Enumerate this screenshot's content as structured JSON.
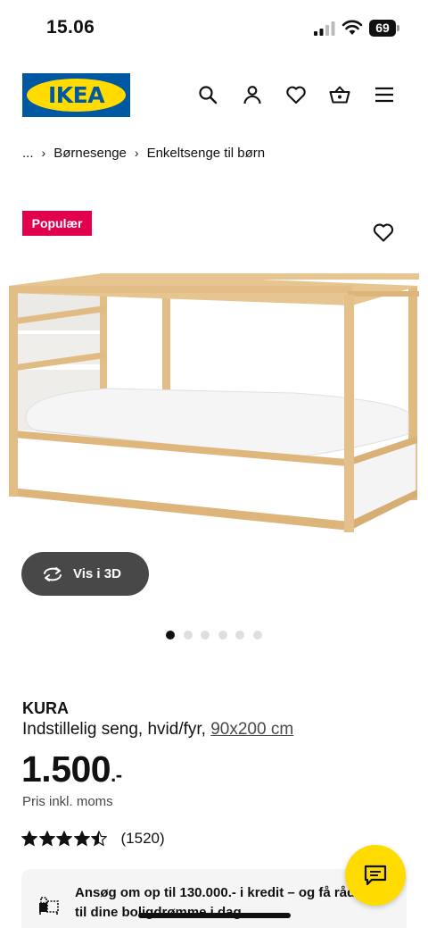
{
  "status_bar": {
    "time": "15.06",
    "battery": "69"
  },
  "header": {
    "logo_text": "IKEA",
    "icons": [
      "search-icon",
      "profile-icon",
      "heart-icon",
      "basket-icon",
      "menu-icon"
    ]
  },
  "breadcrumb": {
    "items": [
      "...",
      "Børnesenge",
      "Enkeltsenge til børn"
    ]
  },
  "product_image": {
    "badge": "Populær",
    "view_3d_label": "Vis i 3D",
    "carousel": {
      "total": 6,
      "active_index": 0
    }
  },
  "product": {
    "name": "KURA",
    "description": "Indstillelig seng, hvid/fyr,",
    "size": "90x200 cm",
    "price": "1.500",
    "price_suffix": ".-",
    "price_note": "Pris inkl. moms",
    "rating": {
      "stars": 4.5,
      "max": 5,
      "count_label": "(1520)"
    }
  },
  "credit_banner": {
    "text": "Ansøg om op til 130.000.- i kredit – og få råd til dine boligdrømme i dag"
  },
  "colors": {
    "ikea_blue": "#0058a3",
    "ikea_yellow": "#ffdb00",
    "badge": "#e0004d",
    "button_dark": "#484848"
  }
}
